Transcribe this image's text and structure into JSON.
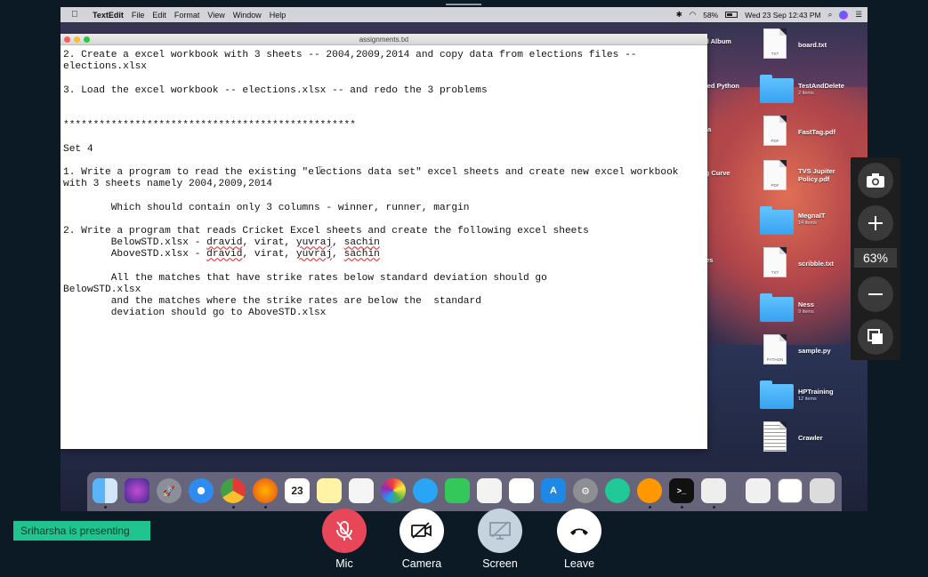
{
  "menubar": {
    "app": "TextEdit",
    "items": [
      "File",
      "Edit",
      "Format",
      "View",
      "Window",
      "Help"
    ],
    "battery": "58%",
    "datetime": "Wed 23 Sep  12:43 PM"
  },
  "window": {
    "title": "assignments.txt",
    "lines": [
      "2. Create a excel workbook with 3 sheets -- 2004,2009,2014 and copy data from elections files --",
      "elections.xlsx",
      "",
      "3. Load the excel workbook -- elections.xlsx -- and redo the 3 problems",
      "",
      "",
      "*************************************************",
      "",
      "Set 4",
      "",
      "1. Write a program to read the existing \"elections data set\" excel sheets and create new excel workbook",
      "with 3 sheets namely 2004,2009,2014",
      "",
      "        Which should contain only 3 columns - winner, runner, margin",
      "",
      "2. Write a program that reads Cricket Excel sheets and create the following excel sheets",
      "        BelowSTD.xlsx - dravid, virat, yuvraj, sachin",
      "        AboveSTD.xlsx - dravid, virat, yuvraj, sachin",
      "",
      "        All the matches that have strike rates below standard deviation should go",
      "BelowSTD.xlsx",
      "        and the matches where the strike rates are below the  standard",
      "        deviation should go to AboveSTD.xlsx"
    ]
  },
  "desktop": {
    "files": [
      {
        "name": "board.txt",
        "sub": "",
        "kind": "TXT"
      },
      {
        "name": "TestAndDelete",
        "sub": "2 items",
        "kind": "folder"
      },
      {
        "name": "FastTag.pdf",
        "sub": "",
        "kind": "PDF"
      },
      {
        "name": "TVS Jupiter Policy.pdf",
        "sub": "",
        "kind": "PDF"
      },
      {
        "name": "MegnaIT",
        "sub": "14 items",
        "kind": "folder"
      },
      {
        "name": "scribble.txt",
        "sub": "",
        "kind": "TXT"
      },
      {
        "name": "Ness",
        "sub": "9 items",
        "kind": "folder"
      },
      {
        "name": "sample.py",
        "sub": "",
        "kind": "PYTHON"
      },
      {
        "name": "HPTraining",
        "sub": "12 items",
        "kind": "folder"
      },
      {
        "name": "Crawler",
        "sub": "",
        "kind": "doc"
      }
    ],
    "cut_labels": [
      "nal Album",
      "nced Python",
      "riya",
      "ing Curve",
      "up",
      "ares"
    ]
  },
  "zoom": {
    "percent": "63%"
  },
  "presenter": "Sriharsha is presenting",
  "controls": {
    "mic": "Mic",
    "camera": "Camera",
    "screen": "Screen",
    "leave": "Leave"
  },
  "colors": {
    "presenter_bg": "#1fc48f",
    "mic_muted": "#e8475a",
    "screen_btn": "#c5d3df"
  }
}
